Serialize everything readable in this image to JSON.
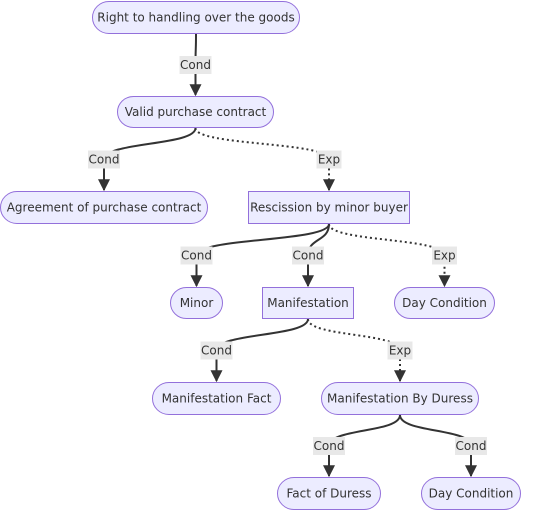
{
  "colors": {
    "node_fill": "#ECECFF",
    "node_stroke": "#9370DB",
    "edge": "#333333",
    "label_bg": "#e8e8e8"
  },
  "nodes": [
    {
      "id": "n1",
      "label": "Right to handling over the goods",
      "shape": "stadium"
    },
    {
      "id": "n2",
      "label": "Valid purchase contract",
      "shape": "stadium"
    },
    {
      "id": "n3",
      "label": "Agreement of purchase contract",
      "shape": "stadium"
    },
    {
      "id": "n4",
      "label": "Rescission by minor buyer",
      "shape": "rect"
    },
    {
      "id": "n5",
      "label": "Minor",
      "shape": "stadium"
    },
    {
      "id": "n6",
      "label": "Manifestation",
      "shape": "rect"
    },
    {
      "id": "n7",
      "label": "Day Condition",
      "shape": "stadium"
    },
    {
      "id": "n8",
      "label": "Manifestation Fact",
      "shape": "stadium"
    },
    {
      "id": "n9",
      "label": "Manifestation By Duress",
      "shape": "stadium"
    },
    {
      "id": "n10",
      "label": "Fact of Duress",
      "shape": "stadium"
    },
    {
      "id": "n11",
      "label": "Day Condition",
      "shape": "stadium"
    }
  ],
  "edges": [
    {
      "from": "n1",
      "to": "n2",
      "label": "Cond",
      "style": "solid"
    },
    {
      "from": "n2",
      "to": "n3",
      "label": "Cond",
      "style": "solid"
    },
    {
      "from": "n2",
      "to": "n4",
      "label": "Exp",
      "style": "dotted"
    },
    {
      "from": "n4",
      "to": "n5",
      "label": "Cond",
      "style": "solid"
    },
    {
      "from": "n4",
      "to": "n6",
      "label": "Cond",
      "style": "solid"
    },
    {
      "from": "n4",
      "to": "n7",
      "label": "Exp",
      "style": "dotted"
    },
    {
      "from": "n6",
      "to": "n8",
      "label": "Cond",
      "style": "solid"
    },
    {
      "from": "n6",
      "to": "n9",
      "label": "Exp",
      "style": "dotted"
    },
    {
      "from": "n9",
      "to": "n10",
      "label": "Cond",
      "style": "solid"
    },
    {
      "from": "n9",
      "to": "n11",
      "label": "Cond",
      "style": "solid"
    }
  ]
}
